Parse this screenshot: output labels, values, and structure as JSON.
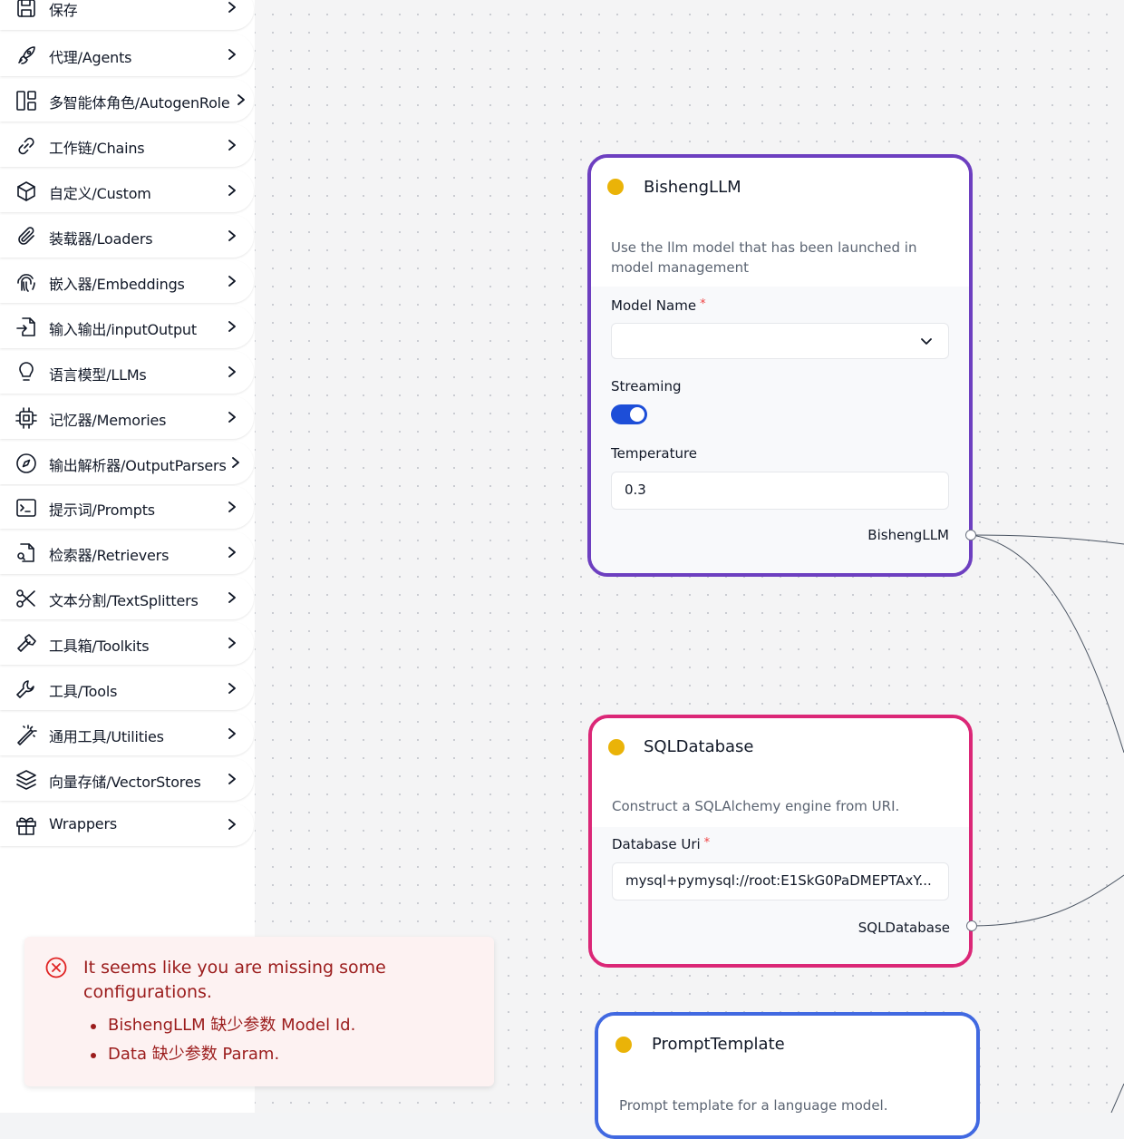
{
  "sidebar": {
    "items": [
      {
        "label": "保存",
        "icon": "save-icon"
      },
      {
        "label": "代理/Agents",
        "icon": "rocket-icon"
      },
      {
        "label": "多智能体角色/AutogenRole",
        "icon": "layout-icon"
      },
      {
        "label": "工作链/Chains",
        "icon": "link-icon"
      },
      {
        "label": "自定义/Custom",
        "icon": "box-icon"
      },
      {
        "label": "装载器/Loaders",
        "icon": "paperclip-icon"
      },
      {
        "label": "嵌入器/Embeddings",
        "icon": "fingerprint-icon"
      },
      {
        "label": "输入输出/inputOutput",
        "icon": "file-input-icon"
      },
      {
        "label": "语言模型/LLMs",
        "icon": "lightbulb-icon"
      },
      {
        "label": "记忆器/Memories",
        "icon": "cpu-icon"
      },
      {
        "label": "输出解析器/OutputParsers",
        "icon": "compass-icon"
      },
      {
        "label": "提示词/Prompts",
        "icon": "terminal-icon"
      },
      {
        "label": "检索器/Retrievers",
        "icon": "file-search-icon"
      },
      {
        "label": "文本分割/TextSplitters",
        "icon": "scissors-icon"
      },
      {
        "label": "工具箱/Toolkits",
        "icon": "hammer-icon"
      },
      {
        "label": "工具/Tools",
        "icon": "wrench-icon"
      },
      {
        "label": "通用工具/Utilities",
        "icon": "wand-icon"
      },
      {
        "label": "向量存储/VectorStores",
        "icon": "layers-icon"
      },
      {
        "label": "Wrappers",
        "icon": "gift-icon"
      }
    ]
  },
  "nodes": {
    "bisheng_llm": {
      "title": "BishengLLM",
      "description": "Use the llm model that has been launched in model management",
      "fields": {
        "model_name_label": "Model Name",
        "model_name_value": "",
        "streaming_label": "Streaming",
        "streaming_on": true,
        "temperature_label": "Temperature",
        "temperature_value": "0.3"
      },
      "output": "BishengLLM",
      "border_color": "#6d3fc0"
    },
    "sql_database": {
      "title": "SQLDatabase",
      "description": "Construct a SQLAlchemy engine from URI.",
      "fields": {
        "database_uri_label": "Database Uri",
        "database_uri_value": "mysql+pymysql://root:E1SkG0PaDMEPTAxY..."
      },
      "output": "SQLDatabase",
      "border_color": "#db2777"
    },
    "prompt_template": {
      "title": "PromptTemplate",
      "description": "Prompt template for a language model.",
      "border_color": "#4169e1"
    }
  },
  "required_marker": "*",
  "toast": {
    "title": "It seems like you are missing some configurations.",
    "errors": [
      "BishengLLM 缺少参数 Model Id.",
      "Data 缺少参数 Param."
    ],
    "color": "#9b1c1c"
  }
}
